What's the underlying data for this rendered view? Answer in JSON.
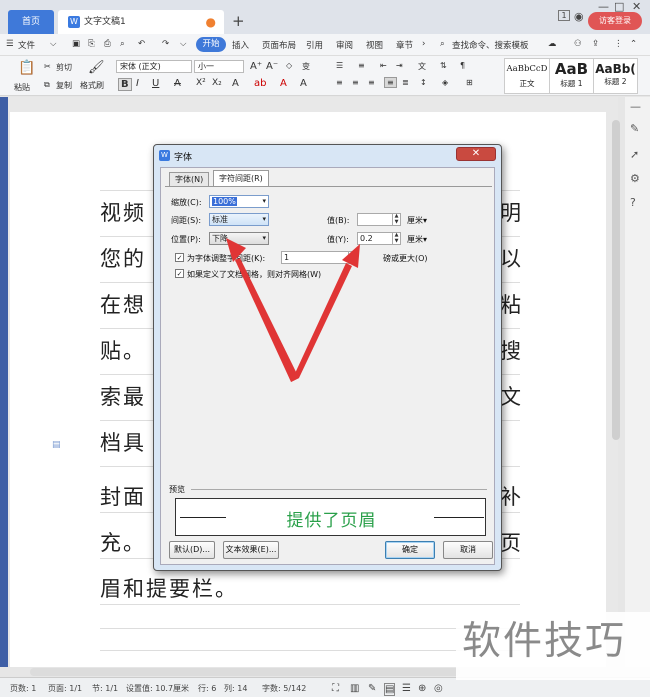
{
  "tabs": {
    "home": "首页",
    "doc": "文字文稿1"
  },
  "title_controls": {
    "badge": "1",
    "login": "访客登录"
  },
  "menu": {
    "file": "文件",
    "items": [
      "开始",
      "插入",
      "页面布局",
      "引用",
      "审阅",
      "视图",
      "章节"
    ],
    "search": "查找命令、搜索模板"
  },
  "ribbon": {
    "paste": "粘贴",
    "cut": "剪切",
    "copy": "复制",
    "format_painter": "格式刷",
    "font_name": "宋体 (正文)",
    "font_size": "小一",
    "styles": [
      {
        "preview": "AaBbCcD",
        "name": "正文"
      },
      {
        "preview": "AaB",
        "name": "标题 1"
      },
      {
        "preview": "AaBb(",
        "name": "标题 2"
      }
    ]
  },
  "document": {
    "lines": [
      "视频",
      "您的",
      "在想",
      "贴。",
      "索最",
      "档具",
      "封面",
      "充。",
      "眉和提要栏。"
    ],
    "right_chars": [
      "明",
      "以",
      "粘",
      "搜",
      "文",
      "",
      "补",
      "页",
      ""
    ]
  },
  "dialog": {
    "title": "字体",
    "close": "✕",
    "tabs": [
      "字体(N)",
      "字符间距(R)"
    ],
    "scale_label": "缩放(C):",
    "scale_value": "100%",
    "spacing_label": "间距(S):",
    "spacing_value": "标准",
    "position_label": "位置(P):",
    "position_value": "下降",
    "value_b_label": "值(B):",
    "value_b": "",
    "unit_b": "厘米",
    "value_y_label": "值(Y):",
    "value_y": "0.2",
    "unit_y": "厘米",
    "kerning_label": "为字体调整字间距(K):",
    "kerning_value": "1",
    "kerning_suffix": "磅或更大(O)",
    "grid_label": "如果定义了文档网格，则对齐网格(W)",
    "preview_label": "预览",
    "preview_text": "提供了页眉",
    "btn_default": "默认(D)...",
    "btn_effects": "文本效果(E)...",
    "btn_ok": "确定",
    "btn_cancel": "取消"
  },
  "status": {
    "pages": "页数: 1",
    "page": "页面: 1/1",
    "section": "节: 1/1",
    "setting": "设置值: 10.7厘米",
    "row": "行: 6",
    "col": "列: 14",
    "words": "字数: 5/142"
  },
  "watermark": "软件技巧",
  "colors": {
    "accent": "#3f79d9",
    "arrow": "#e03535",
    "preview_text": "#2aa04a"
  }
}
